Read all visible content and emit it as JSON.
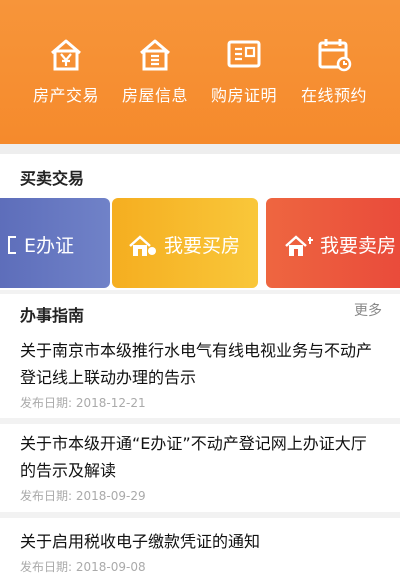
{
  "quick_actions": [
    {
      "label": "房产交易",
      "icon": "yuan-icon"
    },
    {
      "label": "房屋信息",
      "icon": "house-icon"
    },
    {
      "label": "购房证明",
      "icon": "certificate-icon"
    },
    {
      "label": "在线预约",
      "icon": "calendar-icon"
    }
  ],
  "trade_section": {
    "title": "买卖交易",
    "cards": [
      {
        "label": "E办证",
        "color": "#6677c4"
      },
      {
        "label": "我要买房",
        "color": "#f7b52a"
      },
      {
        "label": "我要卖房",
        "color": "#eb5a3c"
      }
    ]
  },
  "guide_section": {
    "title": "办事指南",
    "more": "更多",
    "date_prefix": "发布日期:",
    "items": [
      {
        "title": "关于南京市本级推行水电气有线电视业务与不动产登记线上联动办理的告示",
        "date": "2018-12-21"
      },
      {
        "title": "关于市本级开通“E办证”不动产登记网上办证大厅的告示及解读",
        "date": "2018-09-29"
      },
      {
        "title": "关于启用税收电子缴款凭证的通知",
        "date": "2018-09-08"
      }
    ]
  },
  "colors": {
    "accent": "#f58a2c"
  }
}
